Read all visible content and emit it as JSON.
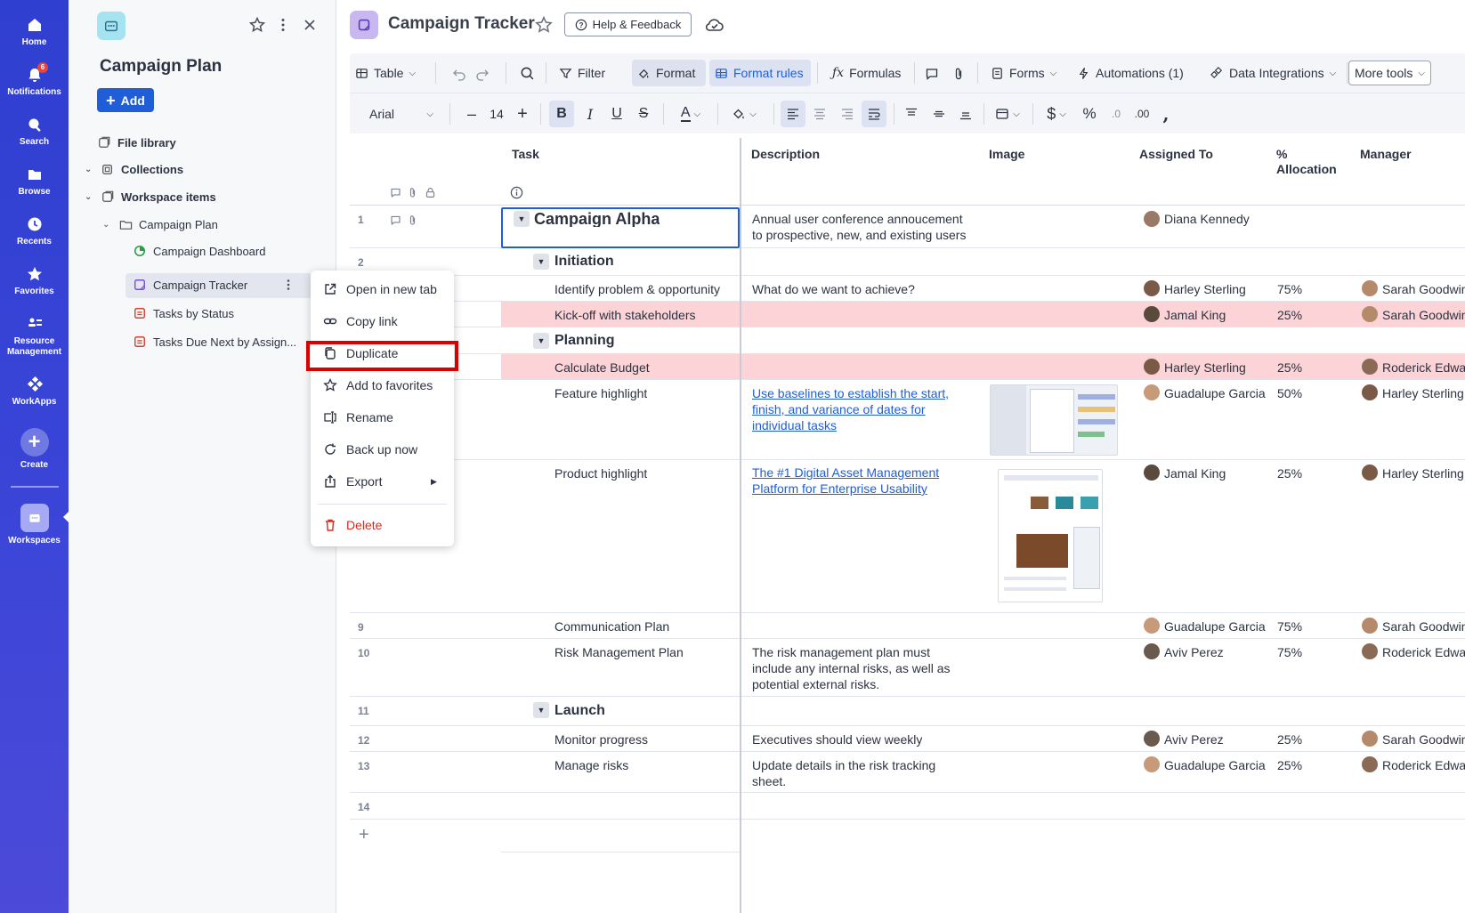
{
  "nav": {
    "items": [
      {
        "label": "Home",
        "icon": "home-icon"
      },
      {
        "label": "Notifications",
        "icon": "bell-icon",
        "badge": "6"
      },
      {
        "label": "Search",
        "icon": "search-icon"
      },
      {
        "label": "Browse",
        "icon": "folder-icon"
      },
      {
        "label": "Recents",
        "icon": "clock-icon"
      },
      {
        "label": "Favorites",
        "icon": "star-icon"
      },
      {
        "label": "Resource Management",
        "icon": "people-icon"
      },
      {
        "label": "WorkApps",
        "icon": "workapps-icon"
      },
      {
        "label": "Create",
        "icon": "plus-icon"
      },
      {
        "label": "Workspaces",
        "icon": "workspace-icon"
      }
    ]
  },
  "panel": {
    "title": "Campaign Plan",
    "add_label": "Add",
    "tree": [
      {
        "label": "File library"
      },
      {
        "label": "Collections"
      },
      {
        "label": "Workspace items"
      },
      {
        "label": "Campaign Plan"
      },
      {
        "label": "Campaign Dashboard"
      },
      {
        "label": "Campaign Tracker"
      },
      {
        "label": "Tasks by Status"
      },
      {
        "label": "Tasks Due Next by Assign..."
      }
    ]
  },
  "context_menu": {
    "items": [
      "Open in new tab",
      "Copy link",
      "Duplicate",
      "Add to favorites",
      "Rename",
      "Back up now",
      "Export",
      "Delete"
    ]
  },
  "header": {
    "title": "Campaign Tracker",
    "help_label": "Help & Feedback"
  },
  "toolbar": {
    "view": "Table",
    "filter": "Filter",
    "format": "Format",
    "format_rules": "Format rules",
    "formulas": "Formulas",
    "forms": "Forms",
    "automations": "Automations (1)",
    "data_integrations": "Data Integrations",
    "more_tools": "More tools",
    "font": "Arial",
    "font_size": "14"
  },
  "grid": {
    "columns": {
      "task": "Task",
      "description": "Description",
      "image": "Image",
      "assigned_to": "Assigned To",
      "allocation": "% Allocation",
      "manager": "Manager"
    },
    "rows": [
      {
        "num": "1",
        "task": "Campaign Alpha",
        "description": "Annual user conference annoucement to prospective, new, and existing users",
        "assigned": "Diana Kennedy",
        "alloc": "",
        "manager": ""
      },
      {
        "num": "2",
        "task": "Initiation",
        "description": "",
        "assigned": "",
        "alloc": "",
        "manager": ""
      },
      {
        "num": "",
        "task": "Identify problem & opportunity",
        "description": "What do we want to achieve?",
        "assigned": "Harley Sterling",
        "alloc": "75%",
        "manager": "Sarah Goodwin"
      },
      {
        "num": "",
        "task": "Kick-off with stakeholders",
        "description": "",
        "assigned": "Jamal King",
        "alloc": "25%",
        "manager": "Sarah Goodwin"
      },
      {
        "num": "",
        "task": "Planning",
        "description": "",
        "assigned": "",
        "alloc": "",
        "manager": ""
      },
      {
        "num": "",
        "task": "Calculate Budget",
        "description": "",
        "assigned": "Harley Sterling",
        "alloc": "25%",
        "manager": "Roderick Edwards"
      },
      {
        "num": "",
        "task": "Feature highlight",
        "description": "Use baselines to establish the start, finish, and variance of dates for individual tasks",
        "assigned": "Guadalupe Garcia",
        "alloc": "50%",
        "manager": "Harley Sterling"
      },
      {
        "num": "",
        "task": "Product highlight",
        "description": "The #1 Digital Asset Management Platform for Enterprise Usability",
        "assigned": "Jamal King",
        "alloc": "25%",
        "manager": "Harley Sterling"
      },
      {
        "num": "9",
        "task": "Communication Plan",
        "description": "",
        "assigned": "Guadalupe Garcia",
        "alloc": "75%",
        "manager": "Sarah Goodwin"
      },
      {
        "num": "10",
        "task": "Risk Management Plan",
        "description": "The risk management plan must include any internal risks, as well as potential external risks.",
        "assigned": "Aviv Perez",
        "alloc": "75%",
        "manager": "Roderick Edwards"
      },
      {
        "num": "11",
        "task": "Launch",
        "description": "",
        "assigned": "",
        "alloc": "",
        "manager": ""
      },
      {
        "num": "12",
        "task": "Monitor progress",
        "description": "Executives should view weekly",
        "assigned": "Aviv Perez",
        "alloc": "25%",
        "manager": "Sarah Goodwin"
      },
      {
        "num": "13",
        "task": "Manage risks",
        "description": "Update details in the risk tracking sheet.",
        "assigned": "Guadalupe Garcia",
        "alloc": "25%",
        "manager": "Roderick Edwards"
      },
      {
        "num": "14",
        "task": "",
        "description": "",
        "assigned": "",
        "alloc": "",
        "manager": ""
      }
    ]
  },
  "colors": {
    "nav_bg": "#3340d4",
    "accent": "#1f5ed6",
    "highlight_row": "#fcd3d7",
    "delete": "#d62d20"
  }
}
